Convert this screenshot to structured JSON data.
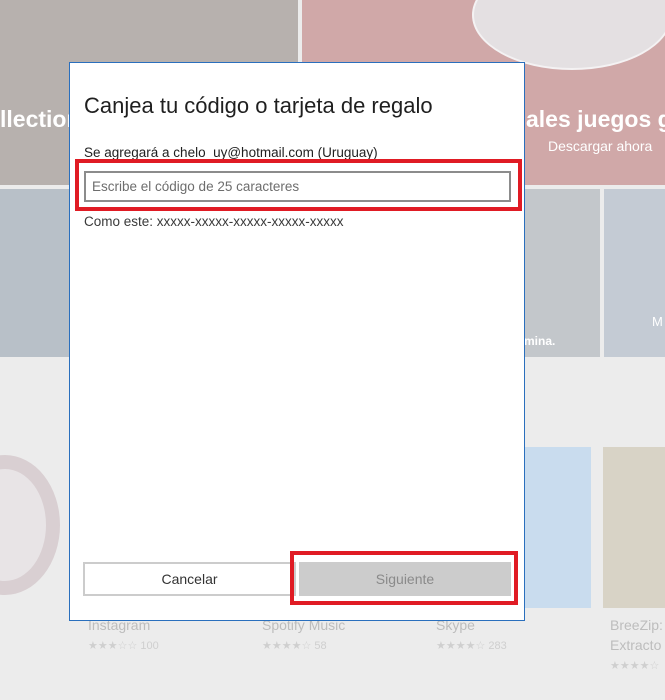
{
  "background": {
    "hero_left_text": "llection",
    "hero_right_text": "ales juegos g",
    "hero_right_subtext": "Descargar ahora",
    "tile_caption": "mina.",
    "tile_caption_right": "M",
    "apps": [
      {
        "name": "Instagram",
        "rating_count": "100"
      },
      {
        "name": "Spotify Music",
        "rating_count": "58"
      },
      {
        "name": "Skype",
        "rating_count": "283"
      },
      {
        "name": "BreeZip:",
        "name_line2": "Extracto"
      }
    ]
  },
  "dialog": {
    "title": "Canjea tu código o tarjeta de regalo",
    "account_line": "Se agregará a chelo_uy@hotmail.com (Uruguay)",
    "code_input": {
      "value": "",
      "placeholder": "Escribe el código de 25 caracteres"
    },
    "format_hint": "Como este: xxxxx-xxxxx-xxxxx-xxxxx-xxxxx",
    "cancel_label": "Cancelar",
    "next_label": "Siguiente"
  },
  "colors": {
    "dialog_border": "#2a6fbd",
    "highlight": "#e01b24",
    "disabled_button": "#cccccc"
  }
}
